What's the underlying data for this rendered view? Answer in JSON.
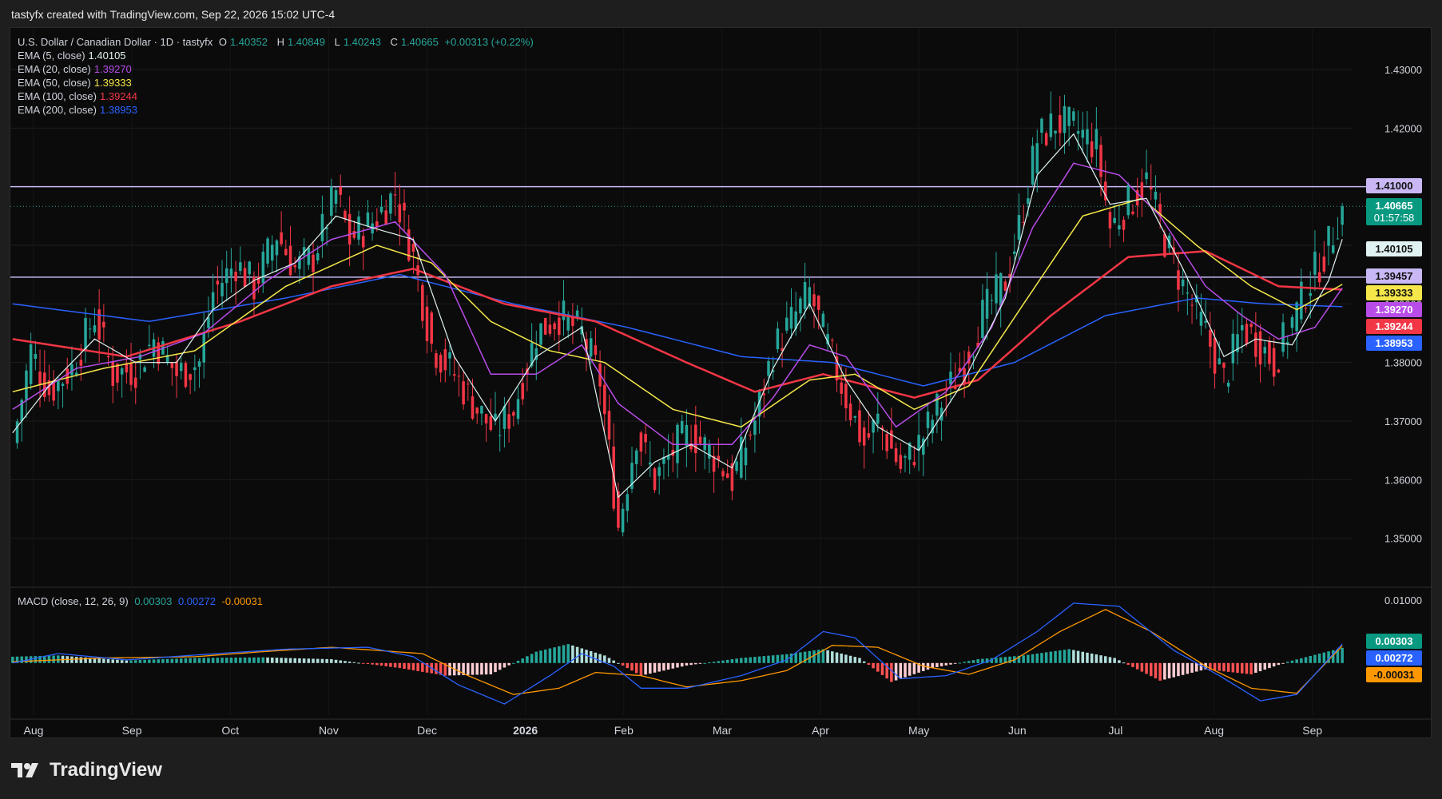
{
  "header": {
    "credit": "tastyfx created with TradingView.com, Sep 22, 2026 15:02 UTC-4"
  },
  "legend": {
    "symbol": "U.S. Dollar / Canadian Dollar · 1D · tastyfx",
    "o_label": "O",
    "o_value": "1.40352",
    "h_label": "H",
    "h_value": "1.40849",
    "l_label": "L",
    "l_value": "1.40243",
    "c_label": "C",
    "c_value": "1.40665",
    "change": "+0.00313 (+0.22%)",
    "emas": [
      {
        "label": "EMA (5, close)",
        "value": "1.40105",
        "color": "#e0f2f1"
      },
      {
        "label": "EMA (20, close)",
        "value": "1.39270",
        "color": "#b84ce8"
      },
      {
        "label": "EMA (50, close)",
        "value": "1.39333",
        "color": "#f5e74a"
      },
      {
        "label": "EMA (100, close)",
        "value": "1.39244",
        "color": "#f23645"
      },
      {
        "label": "EMA (200, close)",
        "value": "1.38953",
        "color": "#2962ff"
      }
    ]
  },
  "macd_legend": {
    "label": "MACD (close, 12, 26, 9)",
    "macd": "0.00303",
    "signal": "0.00272",
    "hist": "-0.00031"
  },
  "tags": {
    "res1": "1.41000",
    "price": "1.40665",
    "countdown": "01:57:58",
    "ema5": "1.40105",
    "res2": "1.39457",
    "ema50": "1.39333",
    "ema20": "1.39270",
    "ema100": "1.39244",
    "ema200": "1.38953",
    "macd": "0.00303",
    "signal": "0.00272",
    "hist": "-0.00031"
  },
  "colors": {
    "up": "#26a69a",
    "down": "#f23645",
    "ema5": "#e0f2f1",
    "ema20": "#b84ce8",
    "ema50": "#f5e74a",
    "ema100": "#f23645",
    "ema200": "#2962ff",
    "level": "#c9b8f5",
    "macd_line": "#2962ff",
    "signal_line": "#ff9800"
  },
  "footer": {
    "brand": "TradingView"
  },
  "chart_data": {
    "type": "candlestick",
    "yaxis_ticks": [
      "1.43000",
      "1.42000",
      "1.41000",
      "1.40000",
      "1.39000",
      "1.38000",
      "1.37000",
      "1.36000",
      "1.35000"
    ],
    "macd_ticks": [
      "0.01000"
    ],
    "x_labels": [
      "Aug",
      "Sep",
      "Oct",
      "Nov",
      "Dec",
      "2026",
      "Feb",
      "Mar",
      "Apr",
      "May",
      "Jun",
      "Jul",
      "Aug",
      "Sep"
    ],
    "ylim": [
      1.343,
      1.436
    ],
    "macd_ylim": [
      -0.007,
      0.0105
    ],
    "horizontal_levels": [
      1.41,
      1.39457
    ],
    "current_price": 1.40665,
    "close_path": [
      [
        0,
        1.366
      ],
      [
        4,
        1.382
      ],
      [
        8,
        1.375
      ],
      [
        13,
        1.379
      ],
      [
        18,
        1.388
      ],
      [
        22,
        1.378
      ],
      [
        27,
        1.379
      ],
      [
        31,
        1.384
      ],
      [
        36,
        1.378
      ],
      [
        41,
        1.38
      ],
      [
        44,
        1.392
      ],
      [
        49,
        1.397
      ],
      [
        53,
        1.393
      ],
      [
        58,
        1.402
      ],
      [
        62,
        1.396
      ],
      [
        66,
        1.398
      ],
      [
        71,
        1.409
      ],
      [
        74,
        1.401
      ],
      [
        79,
        1.404
      ],
      [
        84,
        1.409
      ],
      [
        88,
        1.398
      ],
      [
        92,
        1.383
      ],
      [
        97,
        1.378
      ],
      [
        102,
        1.372
      ],
      [
        106,
        1.368
      ],
      [
        110,
        1.372
      ],
      [
        115,
        1.385
      ],
      [
        120,
        1.388
      ],
      [
        125,
        1.385
      ],
      [
        129,
        1.377
      ],
      [
        133,
        1.352
      ],
      [
        137,
        1.368
      ],
      [
        141,
        1.36
      ],
      [
        146,
        1.366
      ],
      [
        149,
        1.368
      ],
      [
        154,
        1.364
      ],
      [
        158,
        1.36
      ],
      [
        163,
        1.37
      ],
      [
        167,
        1.382
      ],
      [
        171,
        1.387
      ],
      [
        175,
        1.392
      ],
      [
        178,
        1.385
      ],
      [
        183,
        1.374
      ],
      [
        187,
        1.366
      ],
      [
        190,
        1.37
      ],
      [
        195,
        1.362
      ],
      [
        199,
        1.366
      ],
      [
        203,
        1.372
      ],
      [
        209,
        1.38
      ],
      [
        213,
        1.388
      ],
      [
        218,
        1.394
      ],
      [
        221,
        1.403
      ],
      [
        225,
        1.418
      ],
      [
        229,
        1.421
      ],
      [
        233,
        1.42
      ],
      [
        238,
        1.417
      ],
      [
        241,
        1.403
      ],
      [
        245,
        1.407
      ],
      [
        249,
        1.411
      ],
      [
        253,
        1.401
      ],
      [
        257,
        1.393
      ],
      [
        262,
        1.385
      ],
      [
        266,
        1.377
      ],
      [
        270,
        1.386
      ],
      [
        273,
        1.384
      ],
      [
        277,
        1.38
      ],
      [
        281,
        1.387
      ],
      [
        285,
        1.394
      ],
      [
        289,
        1.4
      ],
      [
        292,
        1.40665
      ]
    ],
    "ema5_path": [
      [
        0,
        1.368
      ],
      [
        8,
        1.376
      ],
      [
        18,
        1.384
      ],
      [
        27,
        1.38
      ],
      [
        36,
        1.38
      ],
      [
        44,
        1.389
      ],
      [
        53,
        1.394
      ],
      [
        62,
        1.397
      ],
      [
        71,
        1.405
      ],
      [
        79,
        1.403
      ],
      [
        88,
        1.401
      ],
      [
        97,
        1.381
      ],
      [
        106,
        1.37
      ],
      [
        115,
        1.381
      ],
      [
        125,
        1.386
      ],
      [
        133,
        1.357
      ],
      [
        141,
        1.363
      ],
      [
        149,
        1.366
      ],
      [
        158,
        1.362
      ],
      [
        167,
        1.379
      ],
      [
        175,
        1.39
      ],
      [
        183,
        1.377
      ],
      [
        190,
        1.369
      ],
      [
        199,
        1.365
      ],
      [
        209,
        1.377
      ],
      [
        218,
        1.391
      ],
      [
        225,
        1.412
      ],
      [
        233,
        1.419
      ],
      [
        241,
        1.407
      ],
      [
        249,
        1.408
      ],
      [
        257,
        1.396
      ],
      [
        266,
        1.381
      ],
      [
        273,
        1.384
      ],
      [
        281,
        1.383
      ],
      [
        289,
        1.394
      ],
      [
        292,
        1.40105
      ]
    ],
    "ema20_path": [
      [
        0,
        1.372
      ],
      [
        14,
        1.379
      ],
      [
        28,
        1.381
      ],
      [
        42,
        1.385
      ],
      [
        56,
        1.394
      ],
      [
        70,
        1.401
      ],
      [
        84,
        1.404
      ],
      [
        95,
        1.395
      ],
      [
        105,
        1.378
      ],
      [
        115,
        1.378
      ],
      [
        125,
        1.383
      ],
      [
        133,
        1.373
      ],
      [
        145,
        1.366
      ],
      [
        158,
        1.366
      ],
      [
        167,
        1.374
      ],
      [
        175,
        1.383
      ],
      [
        183,
        1.381
      ],
      [
        194,
        1.369
      ],
      [
        205,
        1.375
      ],
      [
        215,
        1.386
      ],
      [
        224,
        1.403
      ],
      [
        233,
        1.414
      ],
      [
        243,
        1.412
      ],
      [
        252,
        1.405
      ],
      [
        262,
        1.393
      ],
      [
        270,
        1.388
      ],
      [
        278,
        1.384
      ],
      [
        286,
        1.386
      ],
      [
        292,
        1.3927
      ]
    ],
    "ema50_path": [
      [
        0,
        1.375
      ],
      [
        20,
        1.379
      ],
      [
        40,
        1.382
      ],
      [
        60,
        1.393
      ],
      [
        80,
        1.4
      ],
      [
        92,
        1.397
      ],
      [
        105,
        1.387
      ],
      [
        118,
        1.382
      ],
      [
        130,
        1.38
      ],
      [
        145,
        1.372
      ],
      [
        160,
        1.369
      ],
      [
        175,
        1.377
      ],
      [
        185,
        1.378
      ],
      [
        198,
        1.372
      ],
      [
        210,
        1.376
      ],
      [
        222,
        1.39
      ],
      [
        235,
        1.405
      ],
      [
        248,
        1.408
      ],
      [
        260,
        1.4
      ],
      [
        272,
        1.393
      ],
      [
        282,
        1.389
      ],
      [
        292,
        1.39333
      ]
    ],
    "ema100_path": [
      [
        0,
        1.384
      ],
      [
        25,
        1.381
      ],
      [
        50,
        1.387
      ],
      [
        70,
        1.393
      ],
      [
        88,
        1.396
      ],
      [
        108,
        1.39
      ],
      [
        128,
        1.387
      ],
      [
        148,
        1.38
      ],
      [
        163,
        1.375
      ],
      [
        178,
        1.378
      ],
      [
        198,
        1.374
      ],
      [
        212,
        1.377
      ],
      [
        228,
        1.388
      ],
      [
        245,
        1.398
      ],
      [
        262,
        1.399
      ],
      [
        278,
        1.393
      ],
      [
        292,
        1.39244
      ]
    ],
    "ema200_path": [
      [
        0,
        1.39
      ],
      [
        30,
        1.387
      ],
      [
        60,
        1.391
      ],
      [
        85,
        1.395
      ],
      [
        110,
        1.39
      ],
      [
        135,
        1.386
      ],
      [
        160,
        1.381
      ],
      [
        180,
        1.38
      ],
      [
        200,
        1.376
      ],
      [
        220,
        1.38
      ],
      [
        240,
        1.388
      ],
      [
        260,
        1.391
      ],
      [
        275,
        1.39
      ],
      [
        292,
        1.38953
      ]
    ],
    "macd_path": [
      [
        0,
        0
      ],
      [
        10,
        0.0015
      ],
      [
        25,
        0.0005
      ],
      [
        45,
        0.0015
      ],
      [
        60,
        0.0022
      ],
      [
        78,
        0.0025
      ],
      [
        88,
        0.001
      ],
      [
        98,
        -0.0035
      ],
      [
        108,
        -0.0065
      ],
      [
        118,
        -0.002
      ],
      [
        125,
        0.0015
      ],
      [
        132,
        -0.0005
      ],
      [
        138,
        -0.004
      ],
      [
        148,
        -0.004
      ],
      [
        160,
        -0.002
      ],
      [
        170,
        0.0005
      ],
      [
        178,
        0.005
      ],
      [
        185,
        0.004
      ],
      [
        195,
        -0.0025
      ],
      [
        205,
        -0.002
      ],
      [
        215,
        0.0005
      ],
      [
        225,
        0.005
      ],
      [
        233,
        0.0095
      ],
      [
        243,
        0.009
      ],
      [
        255,
        0.002
      ],
      [
        265,
        -0.002
      ],
      [
        274,
        -0.006
      ],
      [
        282,
        -0.005
      ],
      [
        292,
        0.00303
      ]
    ],
    "signal_path": [
      [
        0,
        0.0002
      ],
      [
        20,
        0.0008
      ],
      [
        40,
        0.001
      ],
      [
        55,
        0.0018
      ],
      [
        70,
        0.0025
      ],
      [
        90,
        0.0015
      ],
      [
        100,
        -0.002
      ],
      [
        110,
        -0.005
      ],
      [
        120,
        -0.004
      ],
      [
        128,
        -0.0015
      ],
      [
        138,
        -0.002
      ],
      [
        148,
        -0.0038
      ],
      [
        160,
        -0.0028
      ],
      [
        170,
        -0.0012
      ],
      [
        180,
        0.0028
      ],
      [
        190,
        0.0025
      ],
      [
        200,
        -0.0005
      ],
      [
        210,
        -0.0018
      ],
      [
        220,
        0.0005
      ],
      [
        230,
        0.005
      ],
      [
        240,
        0.0085
      ],
      [
        250,
        0.005
      ],
      [
        262,
        -0.0005
      ],
      [
        272,
        -0.004
      ],
      [
        282,
        -0.0048
      ],
      [
        292,
        0.00272
      ]
    ],
    "hist_path": [
      [
        0,
        0.001
      ],
      [
        10,
        0.0012
      ],
      [
        25,
        0.0004
      ],
      [
        40,
        0.0008
      ],
      [
        55,
        0.0009
      ],
      [
        70,
        0.0006
      ],
      [
        85,
        -0.0008
      ],
      [
        95,
        -0.002
      ],
      [
        105,
        -0.0018
      ],
      [
        115,
        0.0018
      ],
      [
        122,
        0.003
      ],
      [
        130,
        0.0012
      ],
      [
        138,
        -0.002
      ],
      [
        148,
        -0.0004
      ],
      [
        160,
        0.0008
      ],
      [
        170,
        0.0014
      ],
      [
        178,
        0.0022
      ],
      [
        186,
        0.0008
      ],
      [
        193,
        -0.003
      ],
      [
        202,
        -0.0008
      ],
      [
        212,
        0.0006
      ],
      [
        222,
        0.0012
      ],
      [
        232,
        0.0022
      ],
      [
        242,
        0.0008
      ],
      [
        252,
        -0.0028
      ],
      [
        262,
        -0.001
      ],
      [
        272,
        -0.0018
      ],
      [
        280,
        0.0002
      ],
      [
        292,
        0.0024
      ]
    ]
  }
}
